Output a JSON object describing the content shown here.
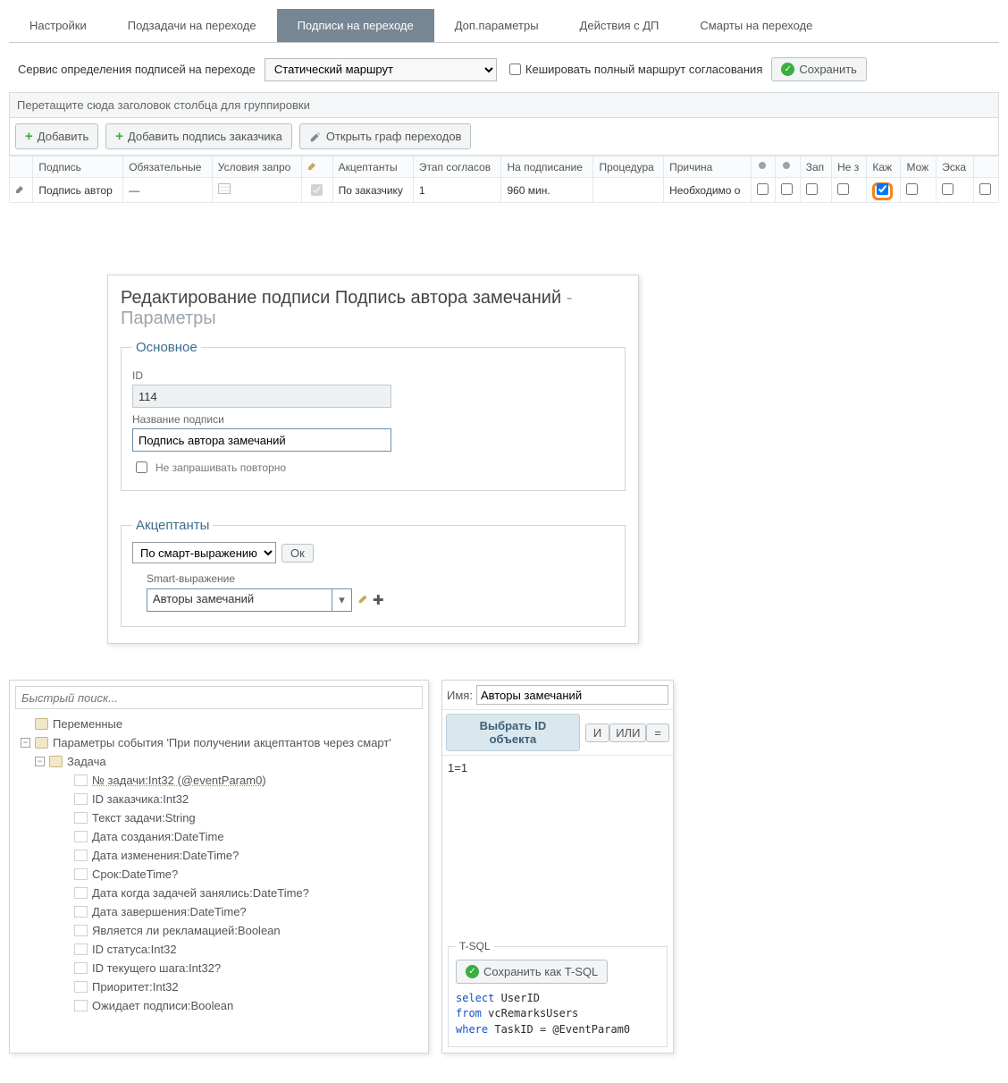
{
  "tabs": [
    "Настройки",
    "Подзадачи на переходе",
    "Подписи на переходе",
    "Доп.параметры",
    "Действия с ДП",
    "Смарты на переходе"
  ],
  "active_tab": 2,
  "service_row": {
    "label": "Сервис определения подписей на переходе",
    "select_value": "Статический маршрут",
    "cache_label": "Кешировать полный маршрут согласования",
    "save_label": "Сохранить"
  },
  "group_bar": "Перетащите сюда заголовок столбца для группировки",
  "grid_toolbar": {
    "add": "Добавить",
    "add_customer": "Добавить подпись заказчика",
    "open_graph": "Открыть граф переходов"
  },
  "grid_cols": [
    "",
    "Подпись",
    "Обязательные",
    "Условия запро",
    "",
    "Акцептанты",
    "Этап согласов",
    "На подписание",
    "Процедура",
    "Причина",
    "",
    "",
    "Зап",
    "Не з",
    "Каж",
    "Мож",
    "Эска",
    ""
  ],
  "grid_row": {
    "col1_signature": "Подпись автор",
    "col2_mandatory": "—",
    "accept_checked": true,
    "accept_by": "По заказчику",
    "stage": "1",
    "on_sign": "960 мин.",
    "reason": "Необходимо о",
    "checks": [
      false,
      false,
      false,
      false,
      true,
      false,
      false,
      false
    ]
  },
  "dialog": {
    "title_prefix": "Редактирование подписи",
    "title_obj": "Подпись автора замечаний",
    "title_sub": "Параметры",
    "section_main": "Основное",
    "id_label": "ID",
    "id_value": "114",
    "name_label": "Название подписи",
    "name_value": "Подпись автора замечаний",
    "dont_reask": "Не запрашивать повторно",
    "section_accept": "Акцептанты",
    "accept_select": "По смарт-выражению",
    "ok": "Ок",
    "smart_label": "Smart-выражение",
    "smart_value": "Авторы замечаний"
  },
  "explorer": {
    "search_placeholder": "Быстрый поиск...",
    "root1": "Переменные",
    "root2": "Параметры события 'При получении акцептантов через смарт'",
    "task": "Задача",
    "items": [
      "№ задачи:Int32 (@eventParam0)",
      "ID заказчика:Int32",
      "Текст задачи:String",
      "Дата создания:DateTime",
      "Дата изменения:DateTime?",
      "Срок:DateTime?",
      "Дата когда задачей занялись:DateTime?",
      "Дата завершения:DateTime?",
      "Является ли рекламацией:Boolean",
      "ID статуса:Int32",
      "ID текущего шага:Int32?",
      "Приоритет:Int32",
      "Ожидает подписи:Boolean"
    ]
  },
  "right_panel": {
    "name_label": "Имя:",
    "name_value": "Авторы замечаний",
    "select_id": "Выбрать ID объекта",
    "and": "И",
    "or": "ИЛИ",
    "eq": "=",
    "condition": "1=1",
    "tsql_legend": "T-SQL",
    "save_tsql": "Сохранить как T-SQL",
    "sql_select": "select",
    "sql_select_ids": "UserID",
    "sql_from": "from",
    "sql_from_id": "vcRemarksUsers",
    "sql_where": "where",
    "sql_where_lhs": "TaskID",
    "sql_where_op": "=",
    "sql_where_rhs": "@EventParam0"
  }
}
